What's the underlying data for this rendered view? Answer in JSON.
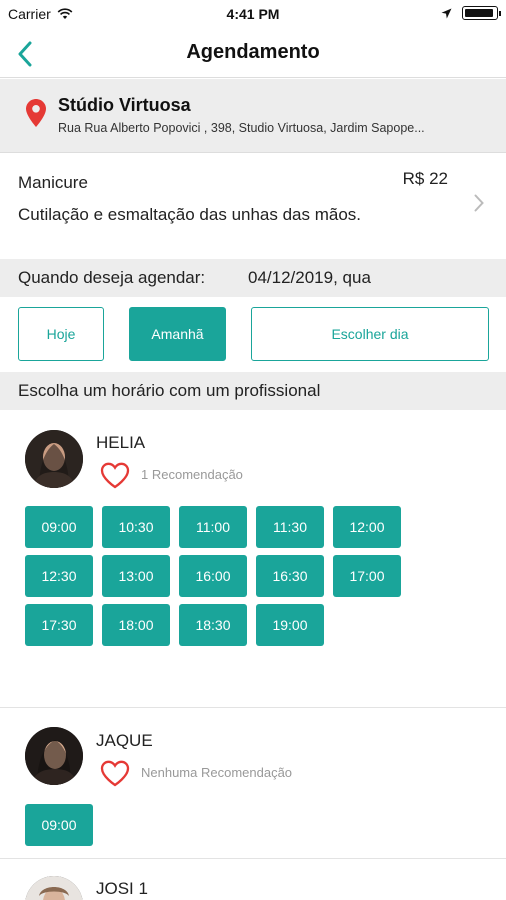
{
  "status_bar": {
    "carrier": "Carrier",
    "time": "4:41 PM"
  },
  "nav": {
    "title": "Agendamento",
    "back_icon": "chevron-left-icon"
  },
  "studio": {
    "name": "Stúdio Virtuosa",
    "address": "Rua Rua Alberto Popovici , 398, Studio Virtuosa, Jardim Sapope...",
    "icon": "location-pin-icon"
  },
  "service": {
    "name": "Manicure",
    "price": "R$ 22",
    "description": "Cutilação e esmaltação das unhas das mãos."
  },
  "schedule": {
    "label": "Quando deseja agendar:",
    "date": "04/12/2019, qua",
    "buttons": {
      "today": "Hoje",
      "tomorrow": "Amanhã",
      "choose": "Escolher dia"
    },
    "selected": "Amanhã"
  },
  "choose_header": "Escolha um horário com um profissional",
  "professionals": [
    {
      "name": "HELIA",
      "recommendation": "1 Recomendação",
      "slots": [
        "09:00",
        "10:30",
        "11:00",
        "11:30",
        "12:00",
        "12:30",
        "13:00",
        "16:00",
        "16:30",
        "17:00",
        "17:30",
        "18:00",
        "18:30",
        "19:00"
      ]
    },
    {
      "name": "JAQUE",
      "recommendation": "Nenhuma Recomendação",
      "slots": [
        "09:00"
      ]
    },
    {
      "name": "JOSI 1",
      "recommendation": "",
      "slots": []
    }
  ],
  "colors": {
    "accent": "#1aa59a",
    "heart": "#e53935",
    "pin": "#e53935",
    "band": "#ededed"
  }
}
